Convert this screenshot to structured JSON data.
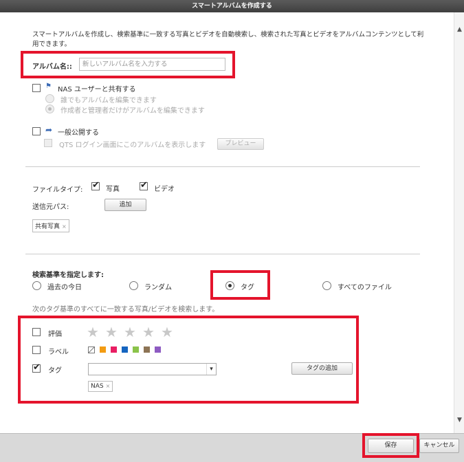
{
  "window": {
    "title": "スマートアルバムを作成する"
  },
  "description": "スマートアルバムを作成し、検索基準に一致する写真とビデオを自動検索し、検索された写真とビデオをアルバムコンテンツとして利用できます。",
  "album_name": {
    "label": "アルバム名::",
    "placeholder": "新しいアルバム名を入力する",
    "value": ""
  },
  "nas_share": {
    "label": "NAS ユーザーと共有する",
    "checked": false,
    "options": [
      {
        "label": "誰でもアルバムを編集できます",
        "selected": false
      },
      {
        "label": "作成者と管理者だけがアルバムを編集できます",
        "selected": true
      }
    ]
  },
  "public": {
    "label": "一般公開する",
    "checked": false,
    "qts_label": "QTS ログイン画面にこのアルバムを表示します",
    "preview_button": "プレビュー"
  },
  "file_type": {
    "label": "ファイルタイプ:",
    "photo": {
      "label": "写真",
      "checked": true
    },
    "video": {
      "label": "ビデオ",
      "checked": true
    }
  },
  "source_path": {
    "label": "送信元パス:",
    "add_button": "追加",
    "chip": "共有写真"
  },
  "criteria": {
    "heading": "検索基準を指定します:",
    "options": [
      {
        "label": "過去の今日",
        "selected": false
      },
      {
        "label": "ランダム",
        "selected": false
      },
      {
        "label": "タグ",
        "selected": true
      },
      {
        "label": "すべてのファイル",
        "selected": false
      }
    ],
    "tag_hint": "次のタグ基準のすべてに一致する写真/ビデオを検索します。"
  },
  "tag_criteria": {
    "rating": {
      "label": "評価",
      "checked": false,
      "stars": 5
    },
    "label": {
      "label": "ラベル",
      "checked": false,
      "colors": [
        "#f39c12",
        "#e91e63",
        "#1565c0",
        "#8bc34a",
        "#8d7455",
        "#8e5bc2"
      ]
    },
    "tag": {
      "label": "タグ",
      "checked": true,
      "select_value": "",
      "add_button": "タグの追加",
      "chip": "NAS"
    }
  },
  "footer": {
    "save_button": "保存",
    "cancel_button": "キャンセル"
  },
  "colors": {
    "highlight": "#e4142c",
    "titlebar": "#4a4a4a",
    "footer": "#d9d9d9"
  }
}
